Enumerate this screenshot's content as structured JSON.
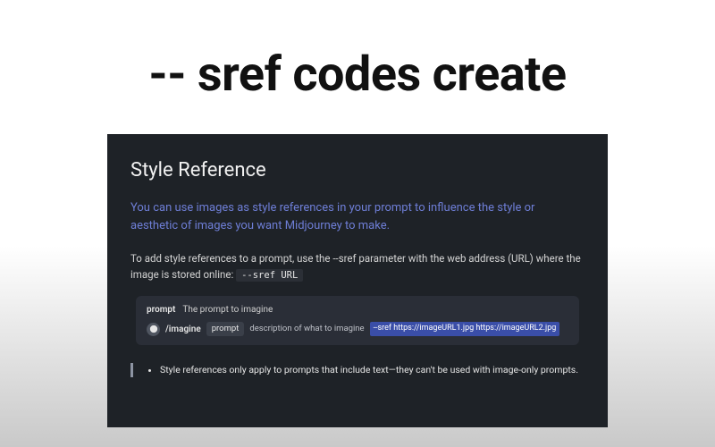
{
  "headline": "-- sref codes create",
  "doc": {
    "title": "Style Reference",
    "intro": "You can use images as style references in your prompt to influence the style or aesthetic of images you want Midjourney to make.",
    "body_prefix": "To add style references to a prompt, use the --sref parameter with the web address (URL) where the image is stored online: ",
    "body_code": "--sref URL",
    "prompt_box": {
      "tag": "prompt",
      "hint": "The prompt to imagine",
      "slash": "/imagine",
      "chip": "prompt",
      "desc": "description of what to imagine",
      "highlight": "--sref https://imageURL1.jpg https://imageURL2.jpg"
    },
    "notes": [
      "Style references only apply to prompts that include text—they can't be used with image-only prompts."
    ]
  }
}
